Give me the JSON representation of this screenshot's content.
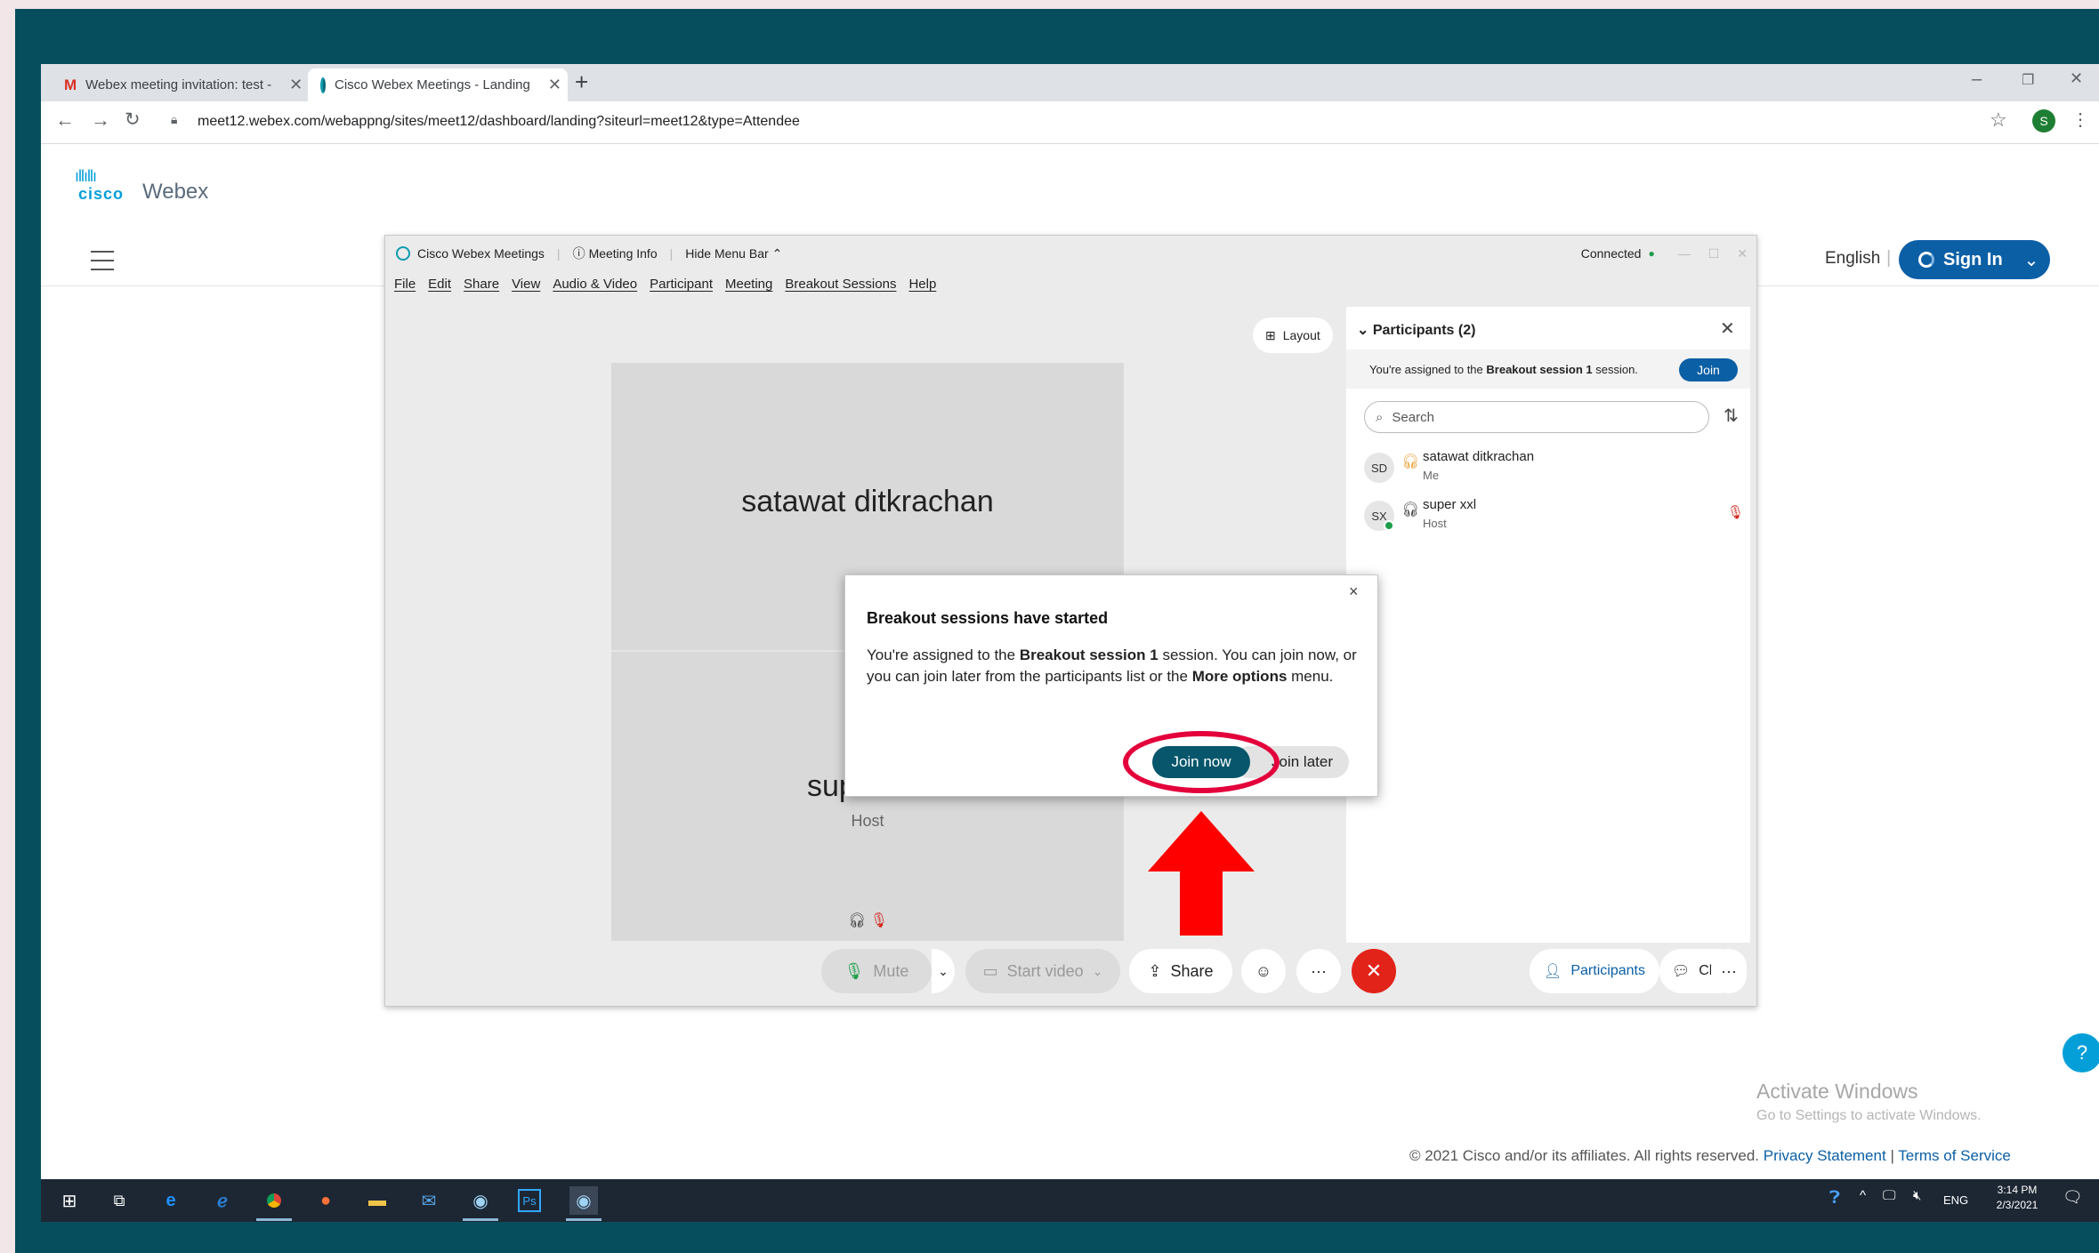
{
  "browser": {
    "tabs": [
      {
        "label": "Webex meeting invitation: test -",
        "icon": "gmail-icon"
      },
      {
        "label": "Cisco Webex Meetings - Landing",
        "icon": "webex-icon"
      }
    ],
    "new_tab": "+",
    "url": "meet12.webex.com/webappng/sites/meet12/dashboard/landing?siteurl=meet12&type=Attendee",
    "profile_initial": "S",
    "window_controls": [
      "–",
      "❐",
      "✕"
    ]
  },
  "site": {
    "brand_cisco": "cisco",
    "brand_webex": "Webex",
    "language": "English",
    "sign_in": "Sign In"
  },
  "meeting": {
    "app_title": "Cisco Webex Meetings",
    "meeting_info": "Meeting Info",
    "hide_menu_bar": "Hide Menu Bar",
    "status": "Connected",
    "menu": [
      "File",
      "Edit",
      "Share",
      "View",
      "Audio & Video",
      "Participant",
      "Meeting",
      "Breakout Sessions",
      "Help"
    ],
    "layout_label": "Layout",
    "tile_top_name": "satawat ditkrachan",
    "tile_bottom_name": "super xxl",
    "tile_bottom_role": "Host"
  },
  "participants": {
    "header": "Participants (2)",
    "assigned_prefix": "You're assigned to the ",
    "assigned_session": "Breakout session 1",
    "assigned_suffix": " session.",
    "join_label": "Join",
    "search_placeholder": "Search",
    "list": [
      {
        "initials": "SD",
        "name": "satawat ditkrachan",
        "role": "Me"
      },
      {
        "initials": "SX",
        "name": "super xxl",
        "role": "Host"
      }
    ]
  },
  "controls": {
    "mute": "Mute",
    "start_video": "Start video",
    "share": "Share",
    "more": "···",
    "participants": "Participants",
    "chat": "Chat"
  },
  "dialog": {
    "title": "Breakout sessions have started",
    "body_1": "You're assigned to the ",
    "body_session": "Breakout session 1",
    "body_2": " session. You can join now, or you can join later from the participants list or the ",
    "body_more": "More options",
    "body_3": " menu.",
    "join_now": "Join now",
    "join_later": "Join later"
  },
  "footer": {
    "activate_title": "Activate Windows",
    "activate_sub": "Go to Settings to activate Windows.",
    "copyright": "© 2021 Cisco and/or its affiliates. All rights reserved.",
    "privacy": "Privacy Statement",
    "separator": "|",
    "terms": "Terms of Service"
  },
  "taskbar": {
    "lang": "ENG",
    "time": "3:14 PM",
    "date": "2/3/2021"
  },
  "colors": {
    "frame": "#064e5e",
    "webex_blue": "#0b5fa5",
    "join_now": "#07566b",
    "highlight": "#e3003b",
    "arrow": "#ff0000",
    "end_call": "#e2231a"
  }
}
